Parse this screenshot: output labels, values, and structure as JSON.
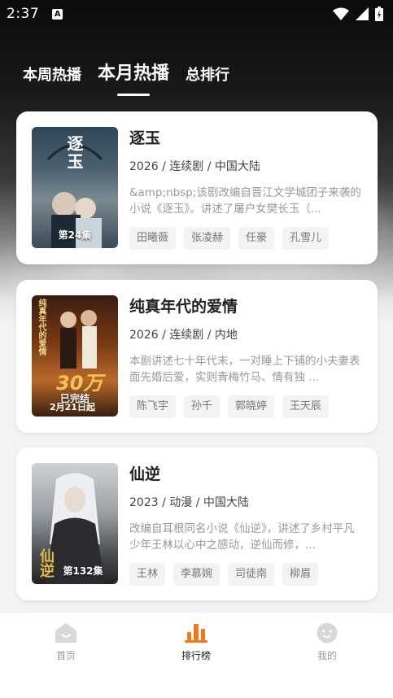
{
  "status_bar": {
    "time": "2:37",
    "notification_icon": "A"
  },
  "tabs": [
    {
      "label": "本周热播",
      "active": false
    },
    {
      "label": "本月热播",
      "active": true
    },
    {
      "label": "总排行",
      "active": false
    }
  ],
  "items": [
    {
      "title": "逐玉",
      "meta": "2026 / 连续剧 / 中国大陆",
      "description": "&amp;nbsp;该剧改编自晋江文学城团子来袭的小说《逐玉》。讲述了屠户女樊长玉（...",
      "poster_label": "第24集",
      "poster_text": "逐玉",
      "cast": [
        "田曦薇",
        "张凌赫",
        "任豪",
        "孔雪儿"
      ]
    },
    {
      "title": "纯真年代的爱情",
      "meta": "2026 / 连续剧 / 内地",
      "description": "本剧讲述七十年代末，一对睡上下铺的小夫妻表面先婚后爱，实则青梅竹马、情有独 ...",
      "poster_label": "已完结",
      "poster_text": "纯真年代的爱情",
      "poster_big": "30万",
      "poster_date": "2月21日起",
      "cast": [
        "陈飞宇",
        "孙千",
        "郭晓婷",
        "王天辰"
      ]
    },
    {
      "title": "仙逆",
      "meta": "2023 / 动漫 / 中国大陆",
      "description": "改编自耳根同名小说《仙逆》，讲述了乡村平凡少年王林以心中之感动，逆仙而修，...",
      "poster_label": "第132集",
      "poster_text": "仙逆",
      "cast": [
        "王林",
        "李慕婉",
        "司徒南",
        "柳眉"
      ]
    }
  ],
  "bottom_nav": [
    {
      "label": "首页",
      "icon": "home-icon",
      "active": false
    },
    {
      "label": "排行榜",
      "icon": "ranking-icon",
      "active": true
    },
    {
      "label": "我的",
      "icon": "profile-icon",
      "active": false
    }
  ],
  "colors": {
    "accent": "#f07a1a",
    "inactive": "#999999"
  }
}
